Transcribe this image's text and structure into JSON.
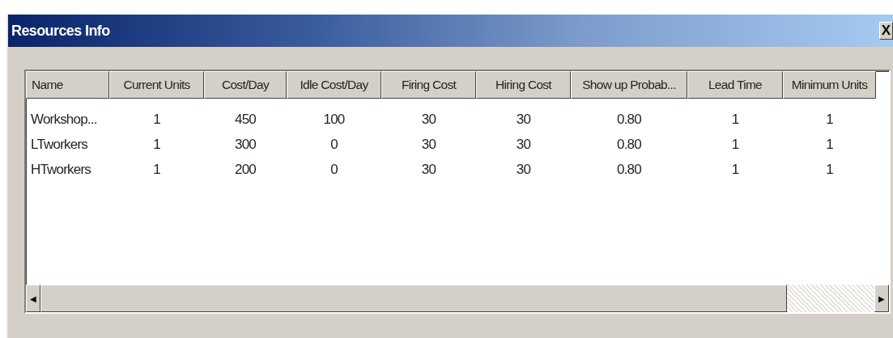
{
  "window": {
    "title": "Resources Info",
    "close_label": "X"
  },
  "table": {
    "columns": [
      "Name",
      "Current Units",
      "Cost/Day",
      "Idle Cost/Day",
      "Firing Cost",
      "Hiring Cost",
      "Show up Probab...",
      "Lead Time",
      "Minimum Units"
    ],
    "rows": [
      [
        "Workshop...",
        "1",
        "450",
        "100",
        "30",
        "30",
        "0.80",
        "1",
        "1"
      ],
      [
        "LTworkers",
        "1",
        "300",
        "0",
        "30",
        "30",
        "0.80",
        "1",
        "1"
      ],
      [
        "HTworkers",
        "1",
        "200",
        "0",
        "30",
        "30",
        "0.80",
        "1",
        "1"
      ]
    ]
  },
  "scrollbar": {
    "left_arrow": "◀",
    "right_arrow": "▶"
  }
}
